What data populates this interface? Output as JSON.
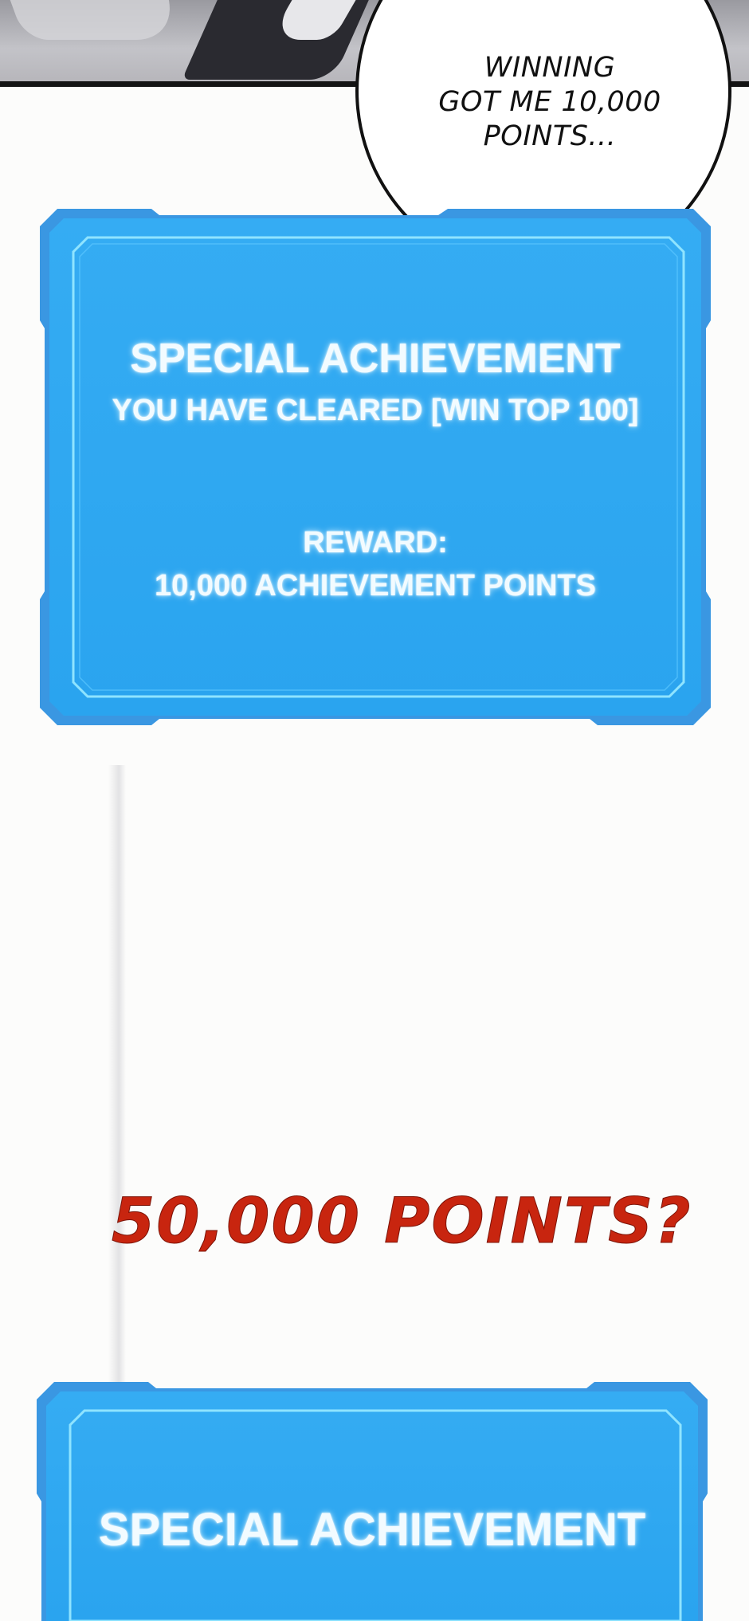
{
  "speech_bubble": {
    "lines": [
      "WINNING",
      "GOT ME 10,000",
      "POINTS..."
    ]
  },
  "achievement_window_1": {
    "title": "SPECIAL ACHIEVEMENT",
    "subtitle": "YOU HAVE CLEARED [WIN TOP 100]",
    "reward_label": "REWARD:",
    "reward_value": "10,000 ACHIEVEMENT POINTS"
  },
  "exclamation": {
    "text": "50,000 POINTS?",
    "color": "#c8250f"
  },
  "achievement_window_2": {
    "title": "SPECIAL ACHIEVEMENT"
  },
  "colors": {
    "window_fill": "#2fa6ef",
    "window_border": "#3d9be6",
    "window_inner_line": "#8fe4ff",
    "text_glow": "#f2fbff"
  }
}
